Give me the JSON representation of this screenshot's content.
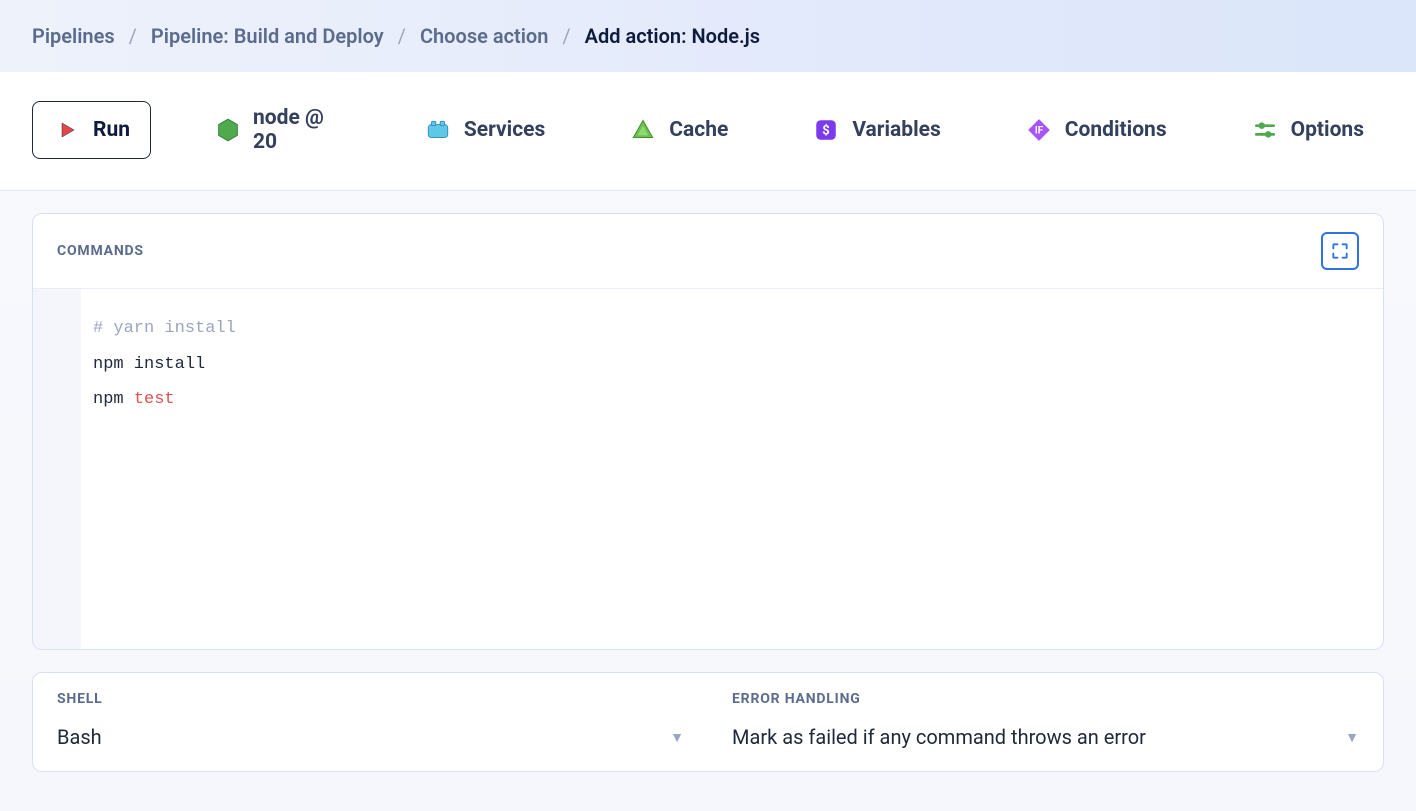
{
  "breadcrumb": {
    "items": [
      {
        "label": "Pipelines",
        "current": false
      },
      {
        "label": "Pipeline: Build and Deploy",
        "current": false
      },
      {
        "label": "Choose action",
        "current": false
      },
      {
        "label": "Add action: Node.js",
        "current": true
      }
    ]
  },
  "tabs": {
    "run": "Run",
    "node": "node @ 20",
    "services": "Services",
    "cache": "Cache",
    "variables": "Variables",
    "conditions": "Conditions",
    "options": "Options"
  },
  "commands": {
    "title": "COMMANDS",
    "lines": [
      {
        "tokens": [
          {
            "t": "# yarn install",
            "cls": "comment"
          }
        ]
      },
      {
        "tokens": [
          {
            "t": "npm install",
            "cls": "default"
          }
        ]
      },
      {
        "tokens": [
          {
            "t": "npm ",
            "cls": "default"
          },
          {
            "t": "test",
            "cls": "keyword"
          }
        ]
      }
    ]
  },
  "shell": {
    "label": "SHELL",
    "value": "Bash"
  },
  "errorHandling": {
    "label": "ERROR HANDLING",
    "value": "Mark as failed if any command throws an error"
  }
}
